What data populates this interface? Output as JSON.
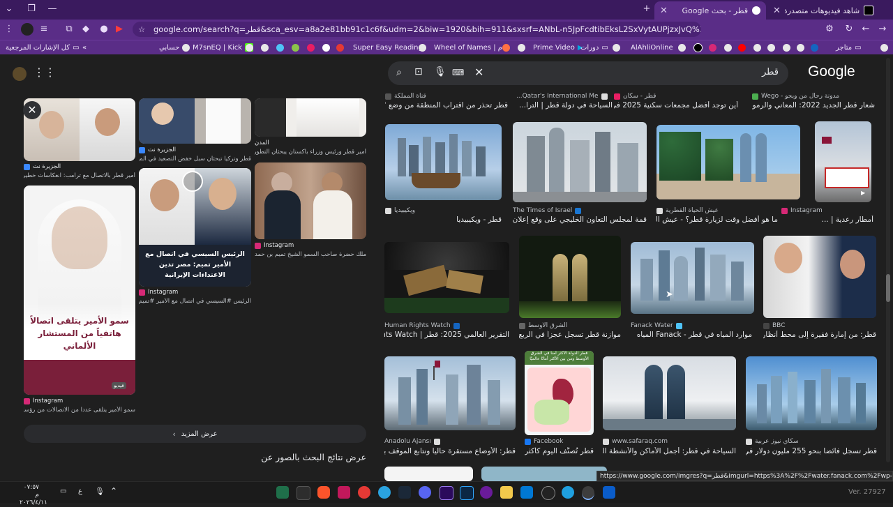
{
  "tabs": [
    {
      "label": "شاهد فيديوهات متصدرة | TikTok",
      "active": false
    },
    {
      "label": "قطر - بحث Google",
      "active": true
    }
  ],
  "address_bar": {
    "url": "google.com/search?q=قطر&sca_esv=a8a2e81bb91c1c6f&udm=2&biw=1920&bih=911&sxsrf=ANbL-n5JpFcdtibEksL2SxVytAUPjzxJvQ%3A1775926510794&ei=7nzaadmVMIWokdUP1PDjwA4&ved=0ahUKEwjZxMrmoeaTAxUFVKQE..."
  },
  "bookmarks": [
    {
      "label": "كل الإشارات المرجعية"
    },
    {
      "label": "حسابي"
    },
    {
      "label": "M7snEQ | Kick"
    },
    {
      "label": "Super Easy Reading"
    },
    {
      "label": "Wheel of Names | م..."
    },
    {
      "label": "Prime Video"
    },
    {
      "label": "دورات"
    },
    {
      "label": "AlAhliOnline"
    },
    {
      "label": "متاجر"
    }
  ],
  "search": {
    "query": "قطر",
    "logo": "Google"
  },
  "left_panel": {
    "cards": [
      {
        "source": "الجزيرة نت",
        "caption": "أمير قطر بالاتصال مع ترامب: انعكاسات خطيرة للتصعيد على..."
      },
      {
        "source": "الجزيرة نت",
        "caption": "قطر وتركيا تبحثان سبل خفض التصعيد في المنطقة | أخبار"
      },
      {
        "source": "المدن",
        "caption": "أمير قطر ورئيس وزراء باكستان يبحثان التطورات الإقليمية"
      },
      {
        "source": "Instagram",
        "caption": "سمو الأمير يتلقى عدداً من الاتصالات من رؤساء حكومات..."
      },
      {
        "source": "Instagram",
        "caption": "الرئيس #السيسي في اتصال مع الأمير #تميم: #مصر تدين..."
      },
      {
        "source": "Instagram",
        "caption": "ملك حضرة صاحب السمو الشيخ تميم بن حمد آل ثاني أمير..."
      }
    ],
    "overlay_text_1": "سمو الأمير يتلقى اتصالاً هاتفياً من المستشار الألماني",
    "overlay_text_2": "الرئيس السيسي في اتصال مع الأمير تميم: مصر تدين الاعتداءات الإيرانية",
    "video_badge": "فيديو",
    "show_more": "عرض المزيد",
    "about_results": "عرض نتائج البحث بالصور عن"
  },
  "top_row_captions": [
    {
      "source": "مدونة رحال من ويجو - Wego",
      "title": "شعار قطر الجديد 2022: المعاني والرموز- رحا..."
    },
    {
      "source": "قطر - سكان",
      "title": "أين توجد أفضل مجمعات سكنية 2025 في ..."
    },
    {
      "source": "Qatar's International Me...",
      "title": "السياحة في دولة قطر | الترا..."
    },
    {
      "source": "قناة المملكة",
      "title": "قطر تحذر من اقتراب المنطقة من وضع \"لا يمكن البتر..."
    }
  ],
  "results": [
    {
      "source": "Instagram",
      "title": "أمطار رعدية | ..."
    },
    {
      "source": "عيش الحياة القطرية",
      "title": "ما هو أفضل وقت لزيارة قطر؟ - عيش الحياة القطرية"
    },
    {
      "source": "The Times of Israel",
      "title": "قمة لمجلس التعاون الخليجي على وقع إعلان فتح الحـ..."
    },
    {
      "source": "ويكيبيديا",
      "title": "قطر - ويكيبيديا"
    },
    {
      "source": "BBC",
      "title": "قطر: من إمارة فقيرة إلى محط أنظار العالم ..."
    },
    {
      "source": "Fanack Water",
      "title": "موارد المياه في قطر - Fanack المياه"
    },
    {
      "source": "الشرق الأوسط",
      "title": "موازنة قطر تسجل عجزاً في الربع الأ..."
    },
    {
      "source": "Human Rights Watch",
      "title": "التقرير العالمي 2025: قطر | Human Rights Watch"
    },
    {
      "source": "سكاي نيوز عربية",
      "title": "قطر تسجل فائضا بنحو 255 مليون دولار في الربـ..."
    },
    {
      "source": "www.safaraq.com",
      "title": "السياحة في قطر: أجمل الأماكن والأنشطة السياحية ..."
    },
    {
      "source": "Facebook",
      "title": "قطر تُصنَّف اليوم كأكثر..."
    },
    {
      "source": "Anadolu Ajansı",
      "title": "قطر: الأوضاع مستقرة حاليا ونتابع الموقف بعد الهـ..."
    }
  ],
  "map_label": "قطر الدولة الأكثر أمناً في الشرق الأوسط ومن بين الأكثر أمانًا عالميًا",
  "status_url": "https://www.google.com/imgres?q=قطر&imgurl=https%3A%2F%2Fwater.fanack.com%2Fwp-content%2Fuploads%2...",
  "taskbar": {
    "time": "٠٧:٥٧ م",
    "date": "٢٠٢٦/٤/١١",
    "lang": "ع",
    "watermark": "Ver. 27927"
  },
  "colors": {
    "tab_bg": "#3a1a5e",
    "toolbar": "#5a2d87",
    "page_bg": "#1f1f1f"
  }
}
